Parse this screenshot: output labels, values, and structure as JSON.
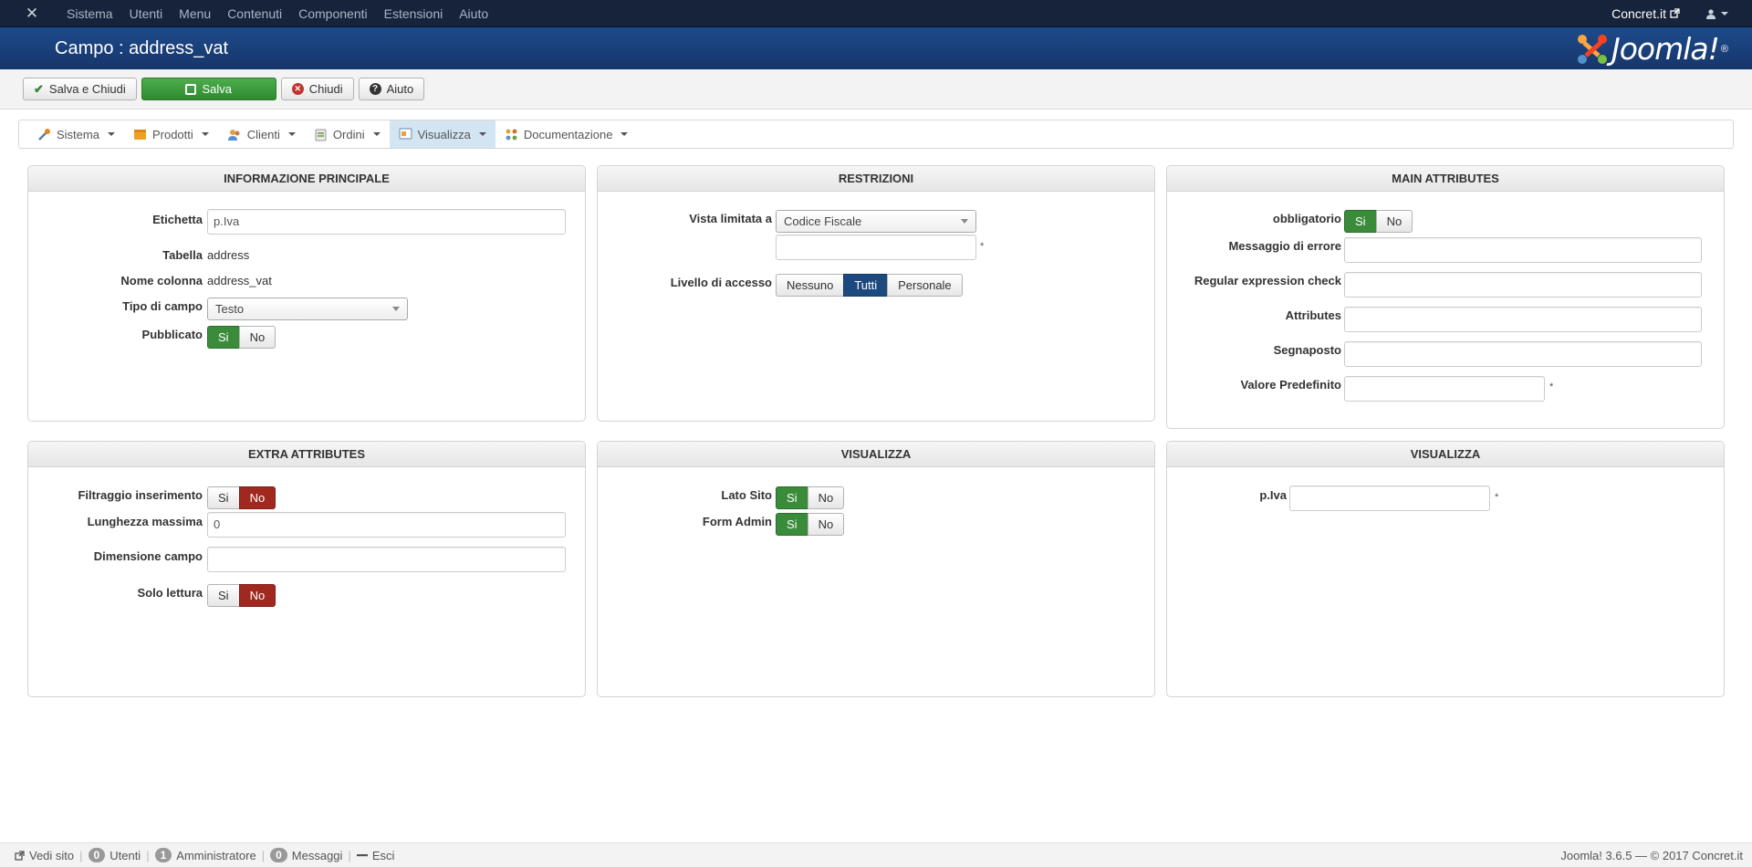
{
  "topnav": {
    "menu": [
      "Sistema",
      "Utenti",
      "Menu",
      "Contenuti",
      "Componenti",
      "Estensioni",
      "Aiuto"
    ],
    "site_label": "Concret.it"
  },
  "header": {
    "title": "Campo : address_vat",
    "brand": "Joomla!",
    "brand_mark": "®"
  },
  "toolbar": {
    "save_close": "Salva e Chiudi",
    "save": "Salva",
    "close": "Chiudi",
    "help": "Aiuto"
  },
  "component_menu": [
    {
      "label": "Sistema",
      "icon": "tools-icon",
      "color": "#e08a1e"
    },
    {
      "label": "Prodotti",
      "icon": "products-icon",
      "color": "#f0a020"
    },
    {
      "label": "Clienti",
      "icon": "customers-icon",
      "color": "#5a8fd0"
    },
    {
      "label": "Ordini",
      "icon": "orders-icon",
      "color": "#9a9a9a"
    },
    {
      "label": "Visualizza",
      "icon": "display-icon",
      "color": "#8da8c4"
    },
    {
      "label": "Documentazione",
      "icon": "docs-icon",
      "color": "#e0a030"
    }
  ],
  "panels": {
    "info": {
      "title": "INFORMAZIONE PRINCIPALE",
      "label_etichetta": "Etichetta",
      "value_etichetta": "p.Iva",
      "label_tabella": "Tabella",
      "value_tabella": "address",
      "label_colonna": "Nome colonna",
      "value_colonna": "address_vat",
      "label_tipo": "Tipo di campo",
      "value_tipo": "Testo",
      "label_pubblicato": "Pubblicato",
      "yes": "Si",
      "no": "No"
    },
    "restrictions": {
      "title": "RESTRIZIONI",
      "label_vista": "Vista limitata a",
      "value_vista": "Codice Fiscale",
      "label_livello": "Livello di accesso",
      "options": [
        "Nessuno",
        "Tutti",
        "Personale"
      ],
      "selected": "Tutti"
    },
    "main_attributes": {
      "title": "MAIN ATTRIBUTES",
      "label_obbligatorio": "obbligatorio",
      "label_errore": "Messaggio di errore",
      "label_regex": "Regular expression check",
      "label_attributes": "Attributes",
      "label_segnaposto": "Segnaposto",
      "label_default": "Valore Predefinito",
      "yes": "Si",
      "no": "No"
    },
    "extra": {
      "title": "EXTRA ATTRIBUTES",
      "label_filtraggio": "Filtraggio inserimento",
      "label_lunghezza": "Lunghezza massima",
      "value_lunghezza": "0",
      "label_dimensione": "Dimensione campo",
      "label_solo": "Solo lettura",
      "yes": "Si",
      "no": "No"
    },
    "display1": {
      "title": "VISUALIZZA",
      "label_lato": "Lato Sito",
      "label_form": "Form Admin",
      "yes": "Si",
      "no": "No"
    },
    "display2": {
      "title": "VISUALIZZA",
      "label_piva": "p.Iva"
    },
    "required_mark": "*"
  },
  "status": {
    "view_site": "Vedi sito",
    "users_count": "0",
    "users_label": "Utenti",
    "admins_count": "1",
    "admins_label": "Amministratore",
    "messages_count": "0",
    "messages_label": "Messaggi",
    "logout": "Esci",
    "version": "Joomla! 3.6.5 — © 2017 Concret.it"
  },
  "colors": {
    "accent_blue": "#1d4a8a",
    "nav_dark": "#17233a",
    "success": "#3a8c3a",
    "danger": "#a0281f"
  }
}
